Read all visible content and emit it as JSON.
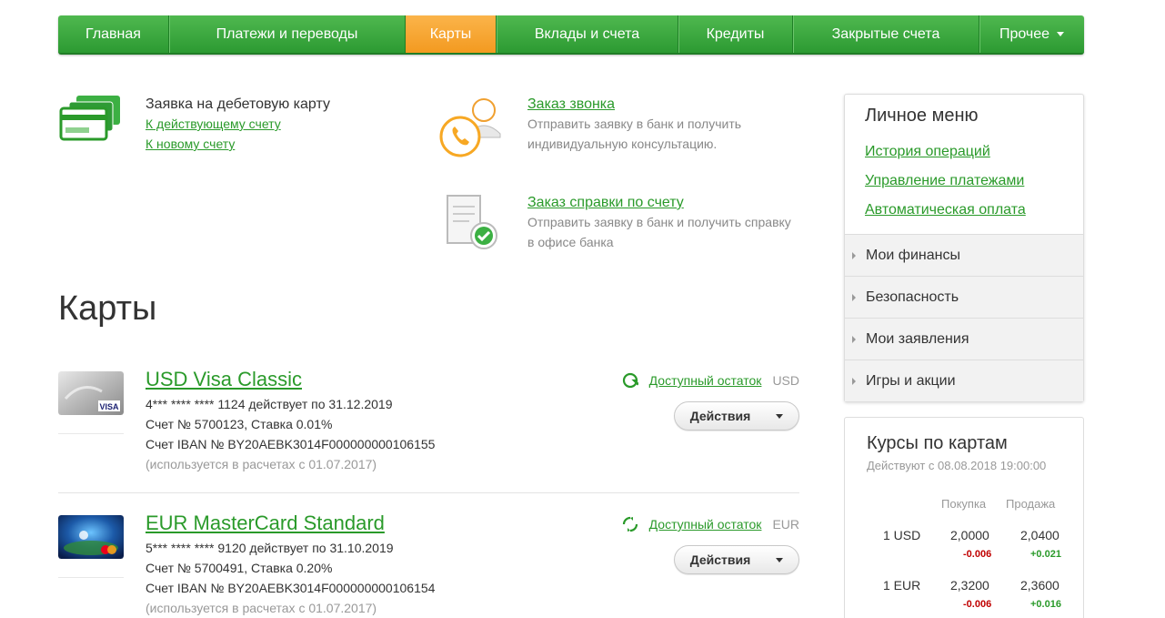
{
  "nav": {
    "items": [
      {
        "label": "Главная"
      },
      {
        "label": "Платежи и переводы"
      },
      {
        "label": "Карты"
      },
      {
        "label": "Вклады и счета"
      },
      {
        "label": "Кредиты"
      },
      {
        "label": "Закрытые счета"
      },
      {
        "label": "Прочее"
      }
    ],
    "active": "Карты"
  },
  "promos": {
    "debit": {
      "title": "Заявка на дебетовую карту",
      "link1": "К действующему счету",
      "link2": "К новому счету"
    },
    "call": {
      "title": "Заказ звонка",
      "desc1": "Отправить заявку в банк и получить",
      "desc2": "индивидуальную консультацию."
    },
    "statement": {
      "title": "Заказ справки по счету",
      "desc1": "Отправить заявку в банк и получить справку",
      "desc2": "в офисе банка"
    }
  },
  "page_title": "Карты",
  "cards": [
    {
      "name": "USD Visa Classic",
      "number_line": "4*** **** **** 1124 действует по 31.12.2019",
      "account_line": "Счет № 5700123, Ставка 0.01%",
      "iban_line": "Счет IBAN № BY20AEBK3014F000000000106155",
      "note": "(используется в расчетах с 01.07.2017)",
      "balance_label": "Доступный остаток",
      "currency": "USD",
      "actions_label": "Действия"
    },
    {
      "name": "EUR MasterCard Standard",
      "number_line": "5*** **** **** 9120 действует по 31.10.2019",
      "account_line": "Счет № 5700491, Ставка 0.20%",
      "iban_line": "Счет IBAN № BY20AEBK3014F000000000106154",
      "note": "(используется в расчетах с 01.07.2017)",
      "balance_label": "Доступный остаток",
      "currency": "EUR",
      "actions_label": "Действия"
    }
  ],
  "menu": {
    "title": "Личное меню",
    "links": [
      "История операций",
      "Управление платежами",
      "Автоматическая оплата"
    ],
    "sections": [
      "Мои финансы",
      "Безопасность",
      "Мои заявления",
      "Игры и акции"
    ]
  },
  "rates": {
    "title": "Курсы по картам",
    "subtitle": "Действуют с 08.08.2018 19:00:00",
    "col_buy": "Покупка",
    "col_sell": "Продажа",
    "rows": [
      {
        "currency": "1 USD",
        "buy": "2,0000",
        "sell": "2,0400",
        "buy_delta": "-0.006",
        "sell_delta": "+0.021"
      },
      {
        "currency": "1 EUR",
        "buy": "2,3200",
        "sell": "2,3600",
        "buy_delta": "-0.006",
        "sell_delta": "+0.016"
      }
    ]
  },
  "colors": {
    "brand_green": "#2a9a2a",
    "active_tab": "#f39a20",
    "negative": "#c00000"
  }
}
